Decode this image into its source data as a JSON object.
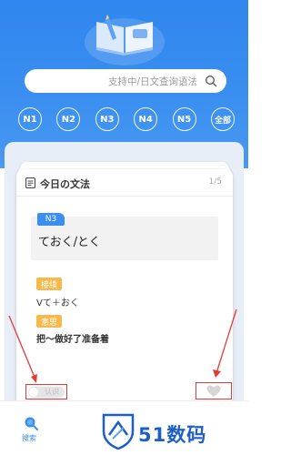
{
  "search": {
    "placeholder": "支持中/日文查询语法"
  },
  "levels": [
    "N1",
    "N2",
    "N3",
    "N4",
    "N5",
    "全部"
  ],
  "card": {
    "title": "今日の文法",
    "page": "1/5",
    "level_tag": "N3",
    "grammar": "ておく/とく",
    "section1_label": "接续",
    "section1_text": "Vて＋おく",
    "section2_label": "意思",
    "section2_text": "把～做好了准备着"
  },
  "toggle": {
    "label": "认识"
  },
  "bottom_nav": {
    "search_label": "搜索"
  },
  "watermark": {
    "text": "51数码"
  },
  "colors": {
    "primary": "#3a8ff0",
    "tag_orange": "#f6b94a",
    "highlight_red": "#e53935"
  }
}
